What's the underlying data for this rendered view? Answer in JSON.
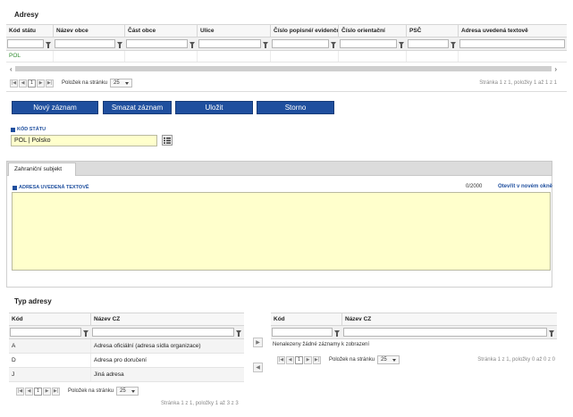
{
  "address_section": {
    "title": "Adresy",
    "columns": [
      "Kód státu",
      "Název obce",
      "Část obce",
      "Ulice",
      "Číslo popisné/ evidenční",
      "Číslo orientační",
      "PSČ",
      "Adresa uvedená textově"
    ],
    "rows": [
      [
        "POL",
        "",
        "",
        "",
        "",
        "",
        "",
        ""
      ]
    ],
    "pager": {
      "current_page": "1",
      "per_page_label": "Položek na stránku",
      "per_page_value": "25",
      "status": "Stránka 1 z 1, položky 1 až 1 z 1"
    }
  },
  "actions": {
    "new_record": "Nový záznam",
    "delete_record": "Smazat záznam",
    "save": "Uložit",
    "cancel": "Storno"
  },
  "country_field": {
    "label": "KÓD STÁTU",
    "value": "POL | Polsko"
  },
  "tabs": {
    "active": "Zahraniční subjekt"
  },
  "text_address": {
    "label": "ADRESA UVEDENÁ TEXTOVĚ",
    "counter": "0/2000",
    "open_link": "Otevřít v novém okně",
    "value": ""
  },
  "address_type": {
    "title": "Typ adresy",
    "left": {
      "columns": [
        "Kód",
        "Název CZ"
      ],
      "rows": [
        [
          "A",
          "Adresa oficiální (adresa sídla organizace)"
        ],
        [
          "D",
          "Adresa pro doručení"
        ],
        [
          "J",
          "Jiná adresa"
        ]
      ],
      "pager": {
        "current_page": "1",
        "per_page_label": "Položek na stránku",
        "per_page_value": "25",
        "status": "Stránka 1 z 1, položky 1 až 3 z 3"
      }
    },
    "right": {
      "columns": [
        "Kód",
        "Název CZ"
      ],
      "empty_text": "Nenalezeny žádné záznamy k zobrazení",
      "pager": {
        "current_page": "1",
        "per_page_label": "Položek na stránku",
        "per_page_value": "25",
        "status": "Stránka 1 z 1, položky 0 až 0 z 0"
      }
    }
  },
  "colors": {
    "primary": "#1f4f9e",
    "input_yellow": "#ffffcc",
    "code_green": "#2e8b2e"
  }
}
